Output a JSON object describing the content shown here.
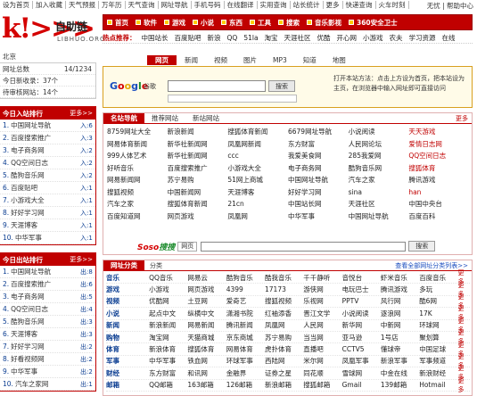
{
  "topbar": {
    "links": [
      "设为首页",
      "加入收藏",
      "天气预报",
      "万年历",
      "天气查询",
      "网址导航",
      "手机号码",
      "在线翻译",
      "实用查询",
      "站长统计",
      "更多",
      "快递查询",
      "火车时刻"
    ],
    "right": "无忧 | 帮助中心"
  },
  "logo": {
    "mark": "k!>>>",
    "name": "自助链",
    "sub": "LIBHUO.ORG"
  },
  "catnav": [
    "首页",
    "软件",
    "游戏",
    "小说",
    "东西",
    "工具",
    "搜索",
    "音乐影视",
    "360安全卫士"
  ],
  "subnav": {
    "label": "热点推荐：",
    "items": [
      "中国站长",
      "百度贴吧",
      "新浪",
      "QQ",
      "51la",
      "淘宝",
      "天涯社区",
      "优酷",
      "开心网",
      "小游戏",
      "农夫",
      "学习资源",
      "在线"
    ]
  },
  "weather": "北京",
  "stats": [
    {
      "label": "网址总数",
      "value": "14/1234"
    },
    {
      "label": "今日新收录：37个",
      "value": ""
    },
    {
      "label": "待审核网站：14个",
      "value": ""
    }
  ],
  "panel1": {
    "title": "今日入站排行",
    "more": "更多>>",
    "rows": [
      {
        "num": "1.",
        "name": "中国网址导航",
        "v": "入:6"
      },
      {
        "num": "2.",
        "name": "百度搜索推广",
        "v": "入:3"
      },
      {
        "num": "3.",
        "name": "电子商务网",
        "v": "入:2"
      },
      {
        "num": "4.",
        "name": "QQ空间日志",
        "v": "入:2"
      },
      {
        "num": "5.",
        "name": "酷狗音乐网",
        "v": "入:2"
      },
      {
        "num": "6.",
        "name": "百度贴吧",
        "v": "入:1"
      },
      {
        "num": "7.",
        "name": "小游戏大全",
        "v": "入:1"
      },
      {
        "num": "8.",
        "name": "好好学习网",
        "v": "入:1"
      },
      {
        "num": "9.",
        "name": "天涯博客",
        "v": "入:1"
      },
      {
        "num": "10.",
        "name": "中华军事",
        "v": "入:1"
      }
    ]
  },
  "panel2": {
    "title": "今日出站排行",
    "more": "更多>>",
    "rows": [
      {
        "num": "1.",
        "name": "中国网址导航",
        "v": "出:8"
      },
      {
        "num": "2.",
        "name": "百度搜索推广",
        "v": "出:6"
      },
      {
        "num": "3.",
        "name": "电子商务网",
        "v": "出:5"
      },
      {
        "num": "4.",
        "name": "QQ空间日志",
        "v": "出:4"
      },
      {
        "num": "5.",
        "name": "酷狗音乐网",
        "v": "出:3"
      },
      {
        "num": "6.",
        "name": "天涯博客",
        "v": "出:3"
      },
      {
        "num": "7.",
        "name": "好好学习网",
        "v": "出:2"
      },
      {
        "num": "8.",
        "name": "好看视频网",
        "v": "出:2"
      },
      {
        "num": "9.",
        "name": "中华军事",
        "v": "出:2"
      },
      {
        "num": "10.",
        "name": "汽车之家网",
        "v": "出:1"
      }
    ]
  },
  "search": {
    "tabs": [
      "网页",
      "新闻",
      "视频",
      "图片",
      "MP3",
      "知道",
      "地图"
    ],
    "active": 0,
    "brand": {
      "g1": "G",
      "o1": "o",
      "o2": "o",
      "g2": "g",
      "l": "l",
      "e": "e"
    },
    "brand_sub": "谷歌",
    "button": "搜索",
    "promo": "打开本站方法：点击上方设为首页，把本站设为主页，在浏览器中输入网址即可直接访问"
  },
  "sites": {
    "tabs": [
      "名站导航",
      "推荐网站",
      "新站网站"
    ],
    "active": 0,
    "more": "更多",
    "cells": [
      "8759网址大全",
      "新浪新闻",
      "搜狐体育新闻",
      "6679网址导航",
      "小说阅读",
      "天天游戏",
      "网易体育新闻",
      "新华社新闻网",
      "凤凰网新闻",
      "东方财富",
      "人民网论坛",
      "爱情日志网",
      "999人体艺术",
      "新华社新闻网",
      "ccc",
      "我爱美食网",
      "285我爱网",
      "QQ空间日志",
      "好听音乐",
      "百度搜索推广",
      "小游戏大全",
      "电子商务网",
      "酷狗音乐网",
      "搜狐体育",
      "网易新闻网",
      "苏宁易购",
      "51网上商城",
      "中国网址导航",
      "汽车之家",
      "腾讯游戏",
      "搜狐视频",
      "中国新闻网",
      "天涯博客",
      "好好学习网",
      "sina",
      "han",
      "汽车之家",
      "搜狐体育新闻",
      "21cn",
      "中国站长网",
      "天涯社区",
      "中国中央台",
      "百度知道网",
      "网页游戏",
      "凤凰网",
      "中华军事",
      "中国网址导航",
      "百度百科"
    ],
    "red": [
      5,
      11,
      17,
      23,
      35
    ],
    "soso": {
      "brand_a": "Soso",
      "brand_b": "搜搜",
      "option": "网页",
      "button": "搜索"
    }
  },
  "webcat": {
    "title": "网址分类",
    "tab2": "分类",
    "more": "查看全部网址分类列表>>",
    "rows": [
      {
        "head": "音乐",
        "items": [
          "QQ音乐",
          "网易云",
          "酷狗音乐",
          "酷我音乐",
          "千千静听",
          "音悦台",
          "虾米音乐",
          "百度音乐"
        ],
        "more": "更多"
      },
      {
        "head": "游戏",
        "items": [
          "小游戏",
          "网页游戏",
          "4399",
          "17173",
          "游侠网",
          "电玩巴士",
          "腾讯游戏",
          "多玩"
        ],
        "more": "更多"
      },
      {
        "head": "视频",
        "items": [
          "优酷网",
          "土豆网",
          "爱奇艺",
          "搜狐视频",
          "乐视网",
          "PPTV",
          "风行网",
          "酷6网"
        ],
        "more": "更多"
      },
      {
        "head": "小说",
        "items": [
          "起点中文",
          "纵横中文",
          "潇湘书院",
          "红袖添香",
          "晋江文学",
          "小说阅读",
          "逐浪网",
          "17K"
        ],
        "more": "更多"
      },
      {
        "head": "新闻",
        "items": [
          "新浪新闻",
          "网易新闻",
          "腾讯新闻",
          "凤凰网",
          "人民网",
          "新华网",
          "中新网",
          "环球网"
        ],
        "more": "更多"
      },
      {
        "head": "购物",
        "items": [
          "淘宝网",
          "天猫商城",
          "京东商城",
          "苏宁易购",
          "当当网",
          "亚马逊",
          "1号店",
          "聚划算"
        ],
        "more": "更多"
      },
      {
        "head": "体育",
        "items": [
          "新浪体育",
          "搜狐体育",
          "网易体育",
          "虎扑体育",
          "直播吧",
          "CCTV5",
          "懂球帝",
          "中国足球"
        ],
        "more": "更多"
      },
      {
        "head": "军事",
        "items": [
          "中华军事",
          "铁血网",
          "环球军事",
          "西陆网",
          "米尔网",
          "凤凰军事",
          "新浪军事",
          "军事频道"
        ],
        "more": "更多"
      },
      {
        "head": "财经",
        "items": [
          "东方财富",
          "和讯网",
          "金融界",
          "证券之星",
          "同花顺",
          "雪球网",
          "中金在线",
          "新浪财经"
        ],
        "more": "更多"
      },
      {
        "head": "邮箱",
        "items": [
          "QQ邮箱",
          "163邮箱",
          "126邮箱",
          "新浪邮箱",
          "搜狐邮箱",
          "Gmail",
          "139邮箱",
          "Hotmail"
        ],
        "more": "更多"
      }
    ]
  }
}
